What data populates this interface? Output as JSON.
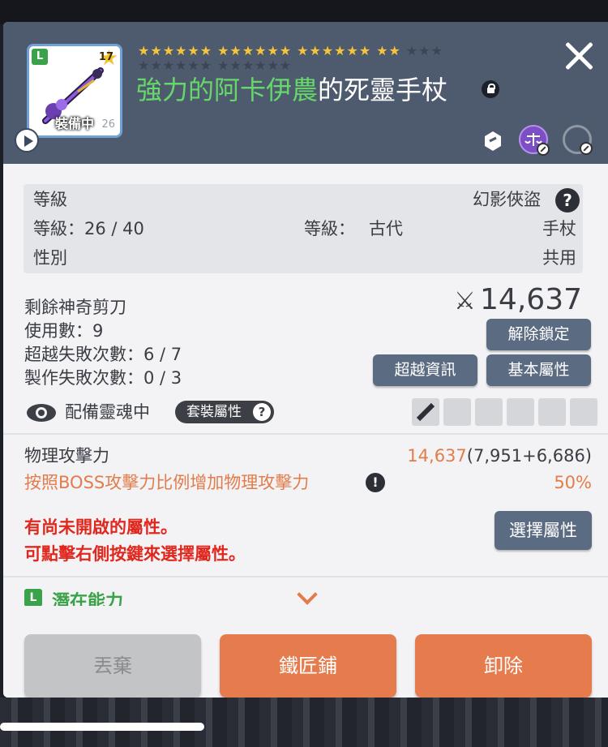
{
  "item": {
    "name_part_green": "強力的阿卡伊農",
    "name_part_white": "的死靈手杖",
    "star_force": "17",
    "equipped_label": "裝備中",
    "icon_level": "26",
    "grade_badge": "L",
    "stars_filled": 22,
    "stars_total": 30
  },
  "info": {
    "level_label": "等級",
    "job": "幻影俠盜",
    "level_value": "等級：26 / 40",
    "grade_label": "等級：",
    "grade_value": "古代",
    "type": "手杖",
    "gender_label": "性別",
    "gender_value": "共用"
  },
  "stats": {
    "scissors": "剩餘神奇剪刀",
    "uses": "使用數：9",
    "transcend_fail": "超越失敗次數：6 / 7",
    "craft_fail": "製作失敗次數：0 / 3",
    "attack_power": "14,637"
  },
  "buttons": {
    "unlock": "解除鎖定",
    "transcend_info": "超越資訊",
    "basic_attr": "基本屬性",
    "select_attr": "選擇屬性",
    "discard": "丟棄",
    "blacksmith": "鐵匠鋪",
    "unequip": "卸除"
  },
  "soul": {
    "label": "配備靈魂中",
    "set_label": "套裝屬性"
  },
  "attributes": {
    "phys_label": "物理攻擊力",
    "phys_value": "14,637",
    "phys_breakdown": "(7,951+6,686)",
    "boss_label": "按照BOSS攻擊力比例增加物理攻擊力",
    "boss_value": "50%",
    "notice_line1": "有尚未開啟的屬性。",
    "notice_line2": "可點擊右側按鍵來選擇屬性。"
  },
  "potential": {
    "badge": "L",
    "label": "潛在能力"
  },
  "colors": {
    "header_bg": "#4e5b6e",
    "accent_orange": "#e67c4e",
    "name_green": "#66d86a",
    "button_dark": "#5b6b82"
  }
}
